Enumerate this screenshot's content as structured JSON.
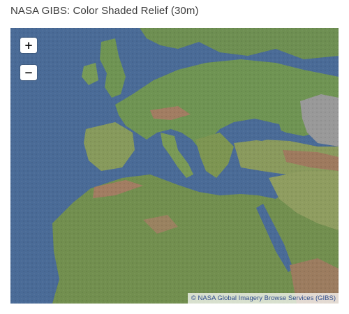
{
  "page": {
    "title": "NASA GIBS: Color Shaded Relief (30m)"
  },
  "map": {
    "layer": "Color Shaded Relief (30m)",
    "controls": {
      "zoom_in_label": "+",
      "zoom_out_label": "−"
    },
    "attribution": "© NASA Global Imagery Browse Services (GIBS)",
    "colors": {
      "sea": "#4a6b97",
      "lowland": "#6f9453",
      "upland": "#8c9b5e",
      "mountain": "#a27d62",
      "no_data": "#999999"
    }
  }
}
